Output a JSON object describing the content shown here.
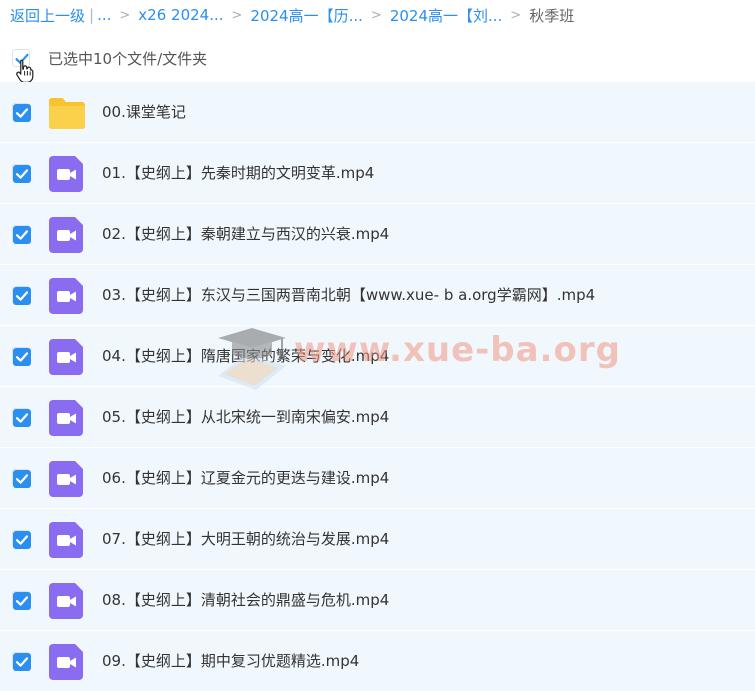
{
  "breadcrumb": {
    "back_label": "返回上一级",
    "ellipsis": "...",
    "crumbs": [
      "x26 2024...",
      "2024高一【历...",
      "2024高一【刘..."
    ],
    "current": "秋季班"
  },
  "selection": {
    "summary": "已选中10个文件/文件夹",
    "all_checked": true
  },
  "files": [
    {
      "name": "00.课堂笔记",
      "type": "folder-icon",
      "checked": true
    },
    {
      "name": "01.【史纲上】先秦时期的文明变革.mp4",
      "type": "video-icon",
      "checked": true
    },
    {
      "name": "02.【史纲上】秦朝建立与西汉的兴衰.mp4",
      "type": "video-icon",
      "checked": true
    },
    {
      "name": "03.【史纲上】东汉与三国两晋南北朝【www.xue- b a.org学霸网】.mp4",
      "type": "video-icon",
      "checked": true
    },
    {
      "name": "04.【史纲上】隋唐国家的繁荣与变化.mp4",
      "type": "video-icon",
      "checked": true
    },
    {
      "name": "05.【史纲上】从北宋统一到南宋偏安.mp4",
      "type": "video-icon",
      "checked": true
    },
    {
      "name": "06.【史纲上】辽夏金元的更迭与建设.mp4",
      "type": "video-icon",
      "checked": true
    },
    {
      "name": "07.【史纲上】大明王朝的统治与发展.mp4",
      "type": "video-icon",
      "checked": true
    },
    {
      "name": "08.【史纲上】清朝社会的鼎盛与危机.mp4",
      "type": "video-icon",
      "checked": true
    },
    {
      "name": "09.【史纲上】期中复习优题精选.mp4",
      "type": "video-icon",
      "checked": true
    }
  ],
  "watermark": {
    "text": "www.xue-ba.org",
    "icon": "graduation-cap-icon"
  },
  "colors": {
    "link": "#2a8ff0",
    "checkbox": "#2a8ff0",
    "row_bg": "#f1f8fd",
    "folder": "#f9c32f",
    "video": "#8a6cf0"
  }
}
